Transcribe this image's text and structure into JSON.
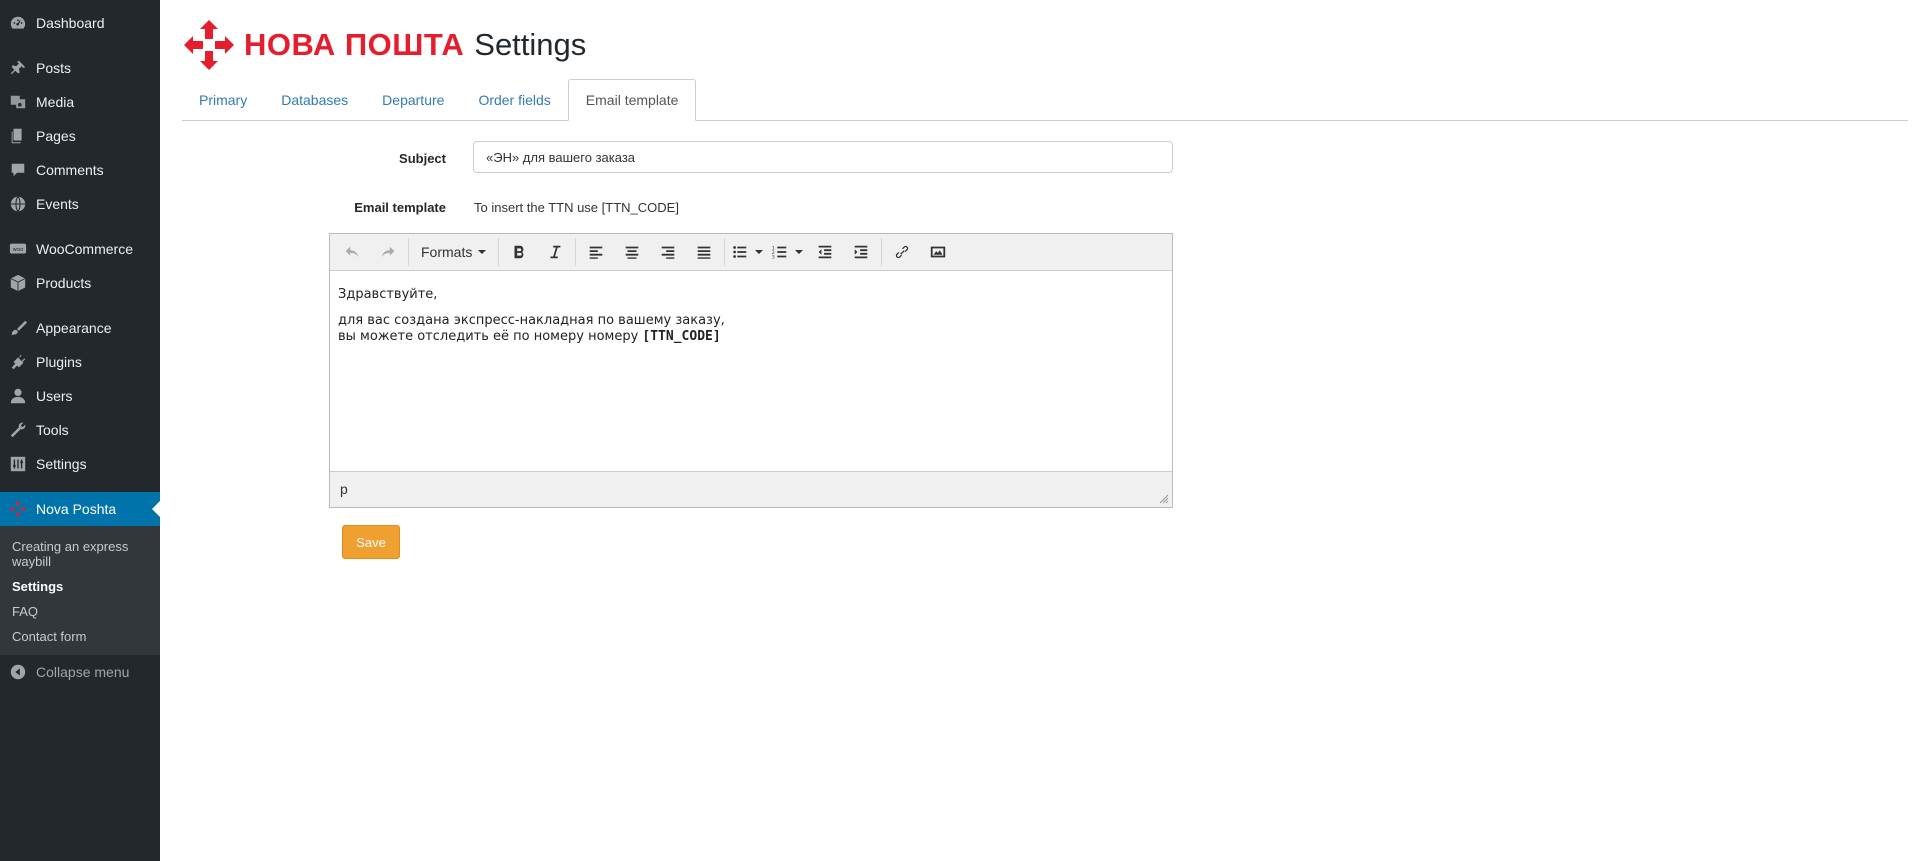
{
  "sidebar": {
    "items": [
      {
        "label": "Dashboard",
        "icon": "dashboard-icon"
      },
      {
        "label": "Posts",
        "icon": "pin-icon"
      },
      {
        "label": "Media",
        "icon": "media-icon"
      },
      {
        "label": "Pages",
        "icon": "pages-icon"
      },
      {
        "label": "Comments",
        "icon": "comment-icon"
      },
      {
        "label": "Events",
        "icon": "globe-icon"
      },
      {
        "label": "WooCommerce",
        "icon": "woo-icon"
      },
      {
        "label": "Products",
        "icon": "box-icon"
      },
      {
        "label": "Appearance",
        "icon": "brush-icon"
      },
      {
        "label": "Plugins",
        "icon": "plugin-icon"
      },
      {
        "label": "Users",
        "icon": "user-icon"
      },
      {
        "label": "Tools",
        "icon": "wrench-icon"
      },
      {
        "label": "Settings",
        "icon": "sliders-icon"
      },
      {
        "label": "Nova Poshta",
        "icon": "nova-poshta-icon"
      }
    ],
    "submenu": [
      "Creating an express waybill",
      "Settings",
      "FAQ",
      "Contact form"
    ],
    "collapse_label": "Collapse menu"
  },
  "header": {
    "brand": "НОВА ПОШТА",
    "title": "Settings",
    "brand_color": "#e41e2d"
  },
  "tabs": [
    "Primary",
    "Databases",
    "Departure",
    "Order fields",
    "Email template"
  ],
  "form": {
    "subject_label": "Subject",
    "subject_value": "«ЭН» для вашего заказа",
    "template_label": "Email template",
    "template_hint": "To insert the TTN use [TTN_CODE]"
  },
  "editor": {
    "formats_label": "Formats",
    "line1": "Здравствуйте,",
    "line2": "для вас создана экспресс-накладная по вашему заказу,",
    "line3_text": "вы можете отследить её по номеру номеру ",
    "line3_code": "[TTN_CODE]",
    "status_path": "p"
  },
  "save_label": "Save",
  "colors": {
    "sidebar_bg": "#23282d",
    "active_menu": "#0073aa",
    "save_button": "#f0a030",
    "tab_link": "#337ab7"
  }
}
